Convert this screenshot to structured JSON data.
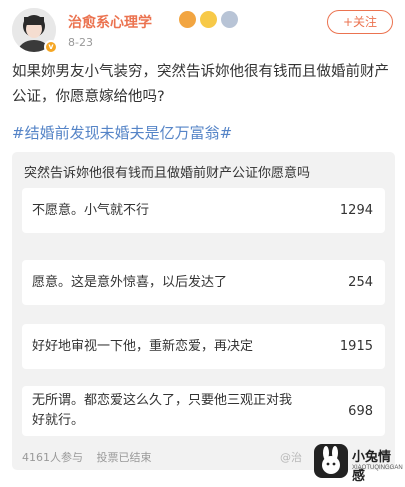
{
  "header": {
    "username": "治愈系心理学",
    "post_time": "8-23",
    "follow_label": "+关注"
  },
  "post": {
    "text": "如果妳男友小气装穷，突然告诉妳他很有钱而且做婚前财产公证，你愿意嫁给他吗?",
    "topic": "#结婚前发现未婚夫是亿万富翁#"
  },
  "poll": {
    "question": "突然告诉妳他很有钱而且做婚前财产公证你愿意吗",
    "options": [
      {
        "label": "不愿意。小气就不行",
        "count": "1294"
      },
      {
        "label": "愿意。这是意外惊喜，以后发达了",
        "count": "254"
      },
      {
        "label": "好好地审视一下他，重新恋爱，再决定",
        "count": "1915"
      },
      {
        "label": "无所谓。都恋爱这么久了，只要他三观正对我好就行。",
        "count": "698"
      }
    ],
    "participants": "4161人参与",
    "status": "投票已结束",
    "watermark": "@治"
  },
  "logo": {
    "name": "小兔情感",
    "sub": "XIAOTUQINGGAN"
  }
}
